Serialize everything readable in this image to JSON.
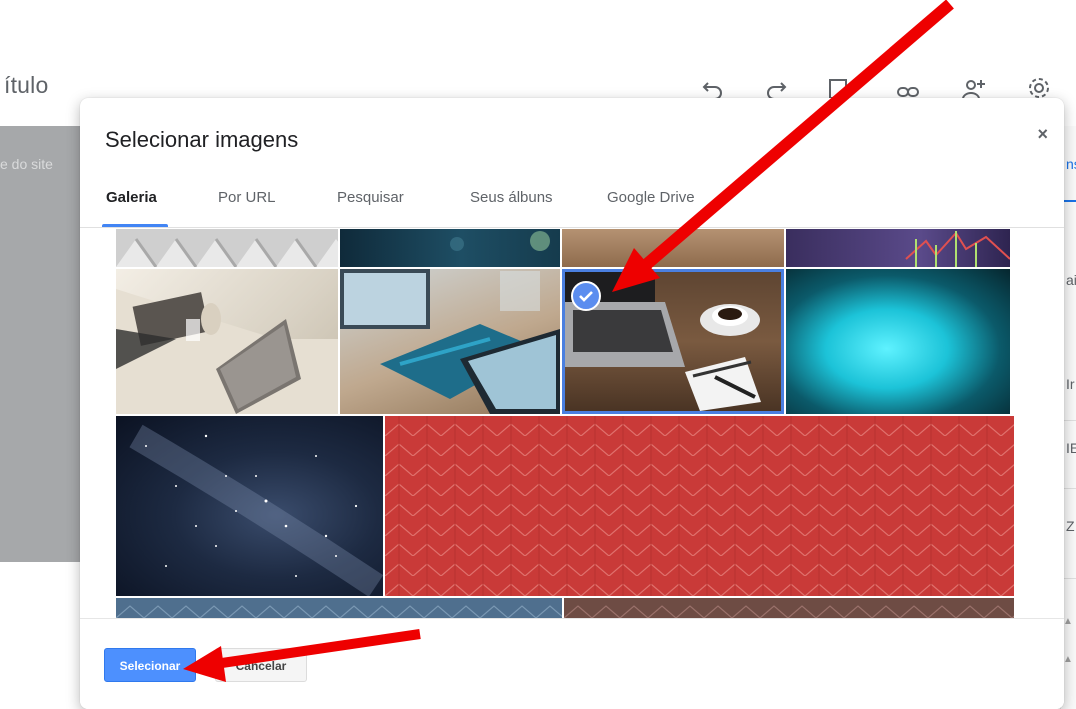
{
  "editor": {
    "doc_title": "ítulo",
    "sidebar_text": "e do site",
    "toolbar_icons": [
      "undo-icon",
      "redo-icon",
      "preview-icon",
      "link-icon",
      "share-icon",
      "settings-icon"
    ],
    "right_panel_texts": [
      "ns",
      "ai",
      "Ir",
      "IE",
      "Z"
    ]
  },
  "dialog": {
    "title": "Selecionar imagens",
    "close_glyph": "×",
    "tabs": [
      {
        "label": "Galeria",
        "active": true
      },
      {
        "label": "Por URL",
        "active": false
      },
      {
        "label": "Pesquisar",
        "active": false
      },
      {
        "label": "Seus álbuns",
        "active": false
      },
      {
        "label": "Google Drive",
        "active": false
      }
    ],
    "gallery": {
      "items": [
        {
          "name": "geometric-tiles-photo",
          "selected": false
        },
        {
          "name": "blue-bokeh-photo",
          "selected": false
        },
        {
          "name": "wood-desk-photo",
          "selected": false
        },
        {
          "name": "stock-chart-photo",
          "selected": false
        },
        {
          "name": "office-desk-laptop-photo",
          "selected": false
        },
        {
          "name": "tablet-notebook-photo",
          "selected": false
        },
        {
          "name": "laptop-coffee-photo",
          "selected": true
        },
        {
          "name": "cyan-blur-photo",
          "selected": false
        },
        {
          "name": "milky-way-photo",
          "selected": false
        },
        {
          "name": "red-chevron-pattern",
          "selected": false
        },
        {
          "name": "blue-chevron-pattern",
          "selected": false
        },
        {
          "name": "brown-chevron-pattern",
          "selected": false
        }
      ]
    },
    "footer": {
      "select_label": "Selecionar",
      "cancel_label": "Cancelar"
    }
  },
  "colors": {
    "accent": "#4285f4",
    "primary_button": "#4d90fe",
    "selection_border": "#4a7fe0",
    "annotation_arrow": "#ee0000"
  }
}
